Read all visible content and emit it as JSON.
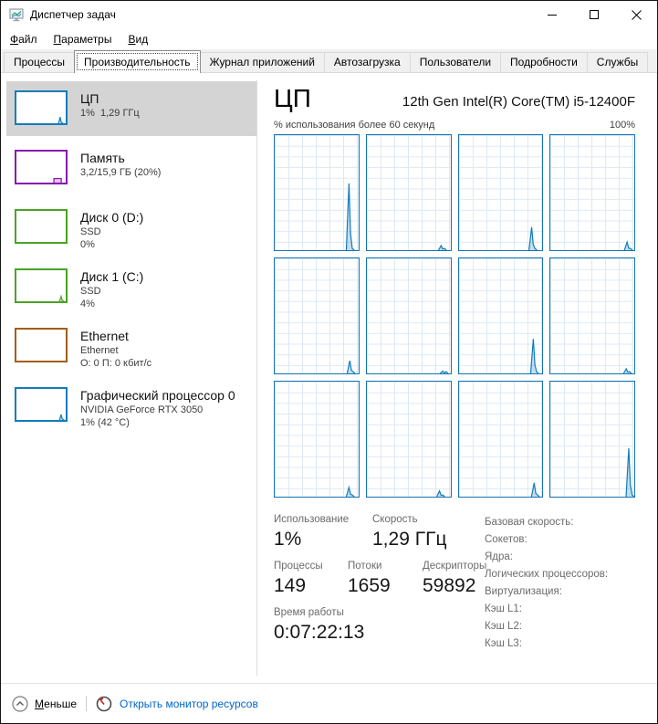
{
  "window": {
    "title": "Диспетчер задач"
  },
  "menu": {
    "items": [
      {
        "id": "file",
        "first": "Ф",
        "rest": "айл"
      },
      {
        "id": "options",
        "first": "П",
        "rest": "араметры"
      },
      {
        "id": "view",
        "first": "В",
        "rest": "ид"
      }
    ]
  },
  "tabs": [
    {
      "id": "processes",
      "label": "Процессы",
      "selected": false
    },
    {
      "id": "performance",
      "label": "Производительность",
      "selected": true
    },
    {
      "id": "app-history",
      "label": "Журнал приложений",
      "selected": false
    },
    {
      "id": "startup",
      "label": "Автозагрузка",
      "selected": false
    },
    {
      "id": "users",
      "label": "Пользователи",
      "selected": false
    },
    {
      "id": "details",
      "label": "Подробности",
      "selected": false
    },
    {
      "id": "services",
      "label": "Службы",
      "selected": false
    }
  ],
  "sidebar": {
    "items": [
      {
        "id": "cpu",
        "title": "ЦП",
        "lines": [
          "1%  1,29 ГГц"
        ],
        "color": "#117dbb",
        "selected": true,
        "spark": {
          "type": "spike",
          "x": 0.9,
          "h": 0.2
        }
      },
      {
        "id": "memory",
        "title": "Память",
        "lines": [
          "3,2/15,9 ГБ (20%)"
        ],
        "color": "#8b12ae",
        "selected": false,
        "spark": {
          "type": "step"
        }
      },
      {
        "id": "disk0",
        "title": "Диск 0 (D:)",
        "lines": [
          "SSD",
          "0%"
        ],
        "color": "#4aa325",
        "selected": false,
        "spark": {
          "type": "none"
        }
      },
      {
        "id": "disk1",
        "title": "Диск 1 (C:)",
        "lines": [
          "SSD",
          "4%"
        ],
        "color": "#4aa325",
        "selected": false,
        "spark": {
          "type": "spike",
          "x": 0.92,
          "h": 0.16
        }
      },
      {
        "id": "ethernet",
        "title": "Ethernet",
        "lines": [
          "Ethernet",
          "О: 0 П: 0 кбит/с"
        ],
        "color": "#a35e10",
        "selected": false,
        "spark": {
          "type": "none"
        }
      },
      {
        "id": "gpu",
        "title": "Графический процессор 0",
        "lines": [
          "NVIDIA GeForce RTX 3050",
          "1% (42 °C)"
        ],
        "color": "#117dbb",
        "selected": false,
        "spark": {
          "type": "spike",
          "x": 0.92,
          "h": 0.18
        }
      }
    ]
  },
  "main": {
    "title": "ЦП",
    "subtitle": "12th Gen Intel(R) Core(TM) i5-12400F",
    "caption_left": "% использования более 60 секунд",
    "caption_right": "100%",
    "accent": "#117dbb",
    "cores": [
      {
        "x": 0.9,
        "h": 0.58
      },
      {
        "x": 0.9,
        "h": 0.04
      },
      {
        "x": 0.88,
        "h": 0.2
      },
      {
        "x": 0.93,
        "h": 0.07
      },
      {
        "x": 0.91,
        "h": 0.11
      },
      {
        "x": 0.92,
        "h": 0.02
      },
      {
        "x": 0.9,
        "h": 0.3
      },
      {
        "x": 0.92,
        "h": 0.04
      },
      {
        "x": 0.9,
        "h": 0.08
      },
      {
        "x": 0.88,
        "h": 0.05
      },
      {
        "x": 0.91,
        "h": 0.12
      },
      {
        "x": 0.95,
        "h": 0.42
      }
    ],
    "stats": {
      "usage_label": "Использование",
      "usage_value": "1%",
      "speed_label": "Скорость",
      "speed_value": "1,29 ГГц",
      "processes_label": "Процессы",
      "processes_value": "149",
      "threads_label": "Потоки",
      "threads_value": "1659",
      "handles_label": "Дескрипторы",
      "handles_value": "59892",
      "uptime_label": "Время работы",
      "uptime_value": "0:07:22:13"
    },
    "details": [
      "Базовая скорость:",
      "Сокетов:",
      "Ядра:",
      "Логических процессоров:",
      "Виртуализация:",
      "Кэш L1:",
      "Кэш L2:",
      "Кэш L3:"
    ]
  },
  "footer": {
    "less_first": "М",
    "less_rest": "еньше",
    "open_link": "Открыть монитор ресурсов"
  }
}
